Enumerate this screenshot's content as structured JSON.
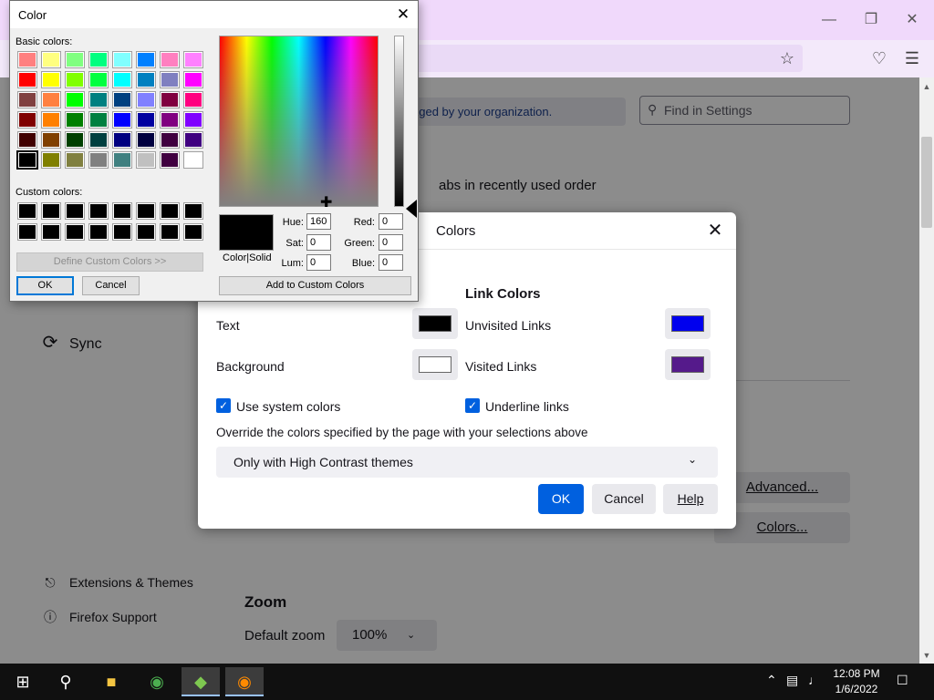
{
  "browser": {
    "window_controls": {
      "minimize_icon": "minimize-icon",
      "restore_icon": "restore-icon",
      "close_icon": "close-icon"
    },
    "toolbar": {
      "bookmark_icon": "star-icon",
      "pocket_icon": "pocket-icon",
      "menu_icon": "hamburger-menu-icon"
    },
    "settings": {
      "managed_notice": "aged by your organization.",
      "find_placeholder": "Find in Settings",
      "tabs_text": "abs in recently used order",
      "advanced_button": "Advanced...",
      "colors_button": "Colors...",
      "zoom_heading": "Zoom",
      "default_zoom_label": "Default zoom",
      "default_zoom_value": "100%",
      "sidebar": {
        "sync": "Sync",
        "extensions": "Extensions & Themes",
        "support": "Firefox Support"
      }
    }
  },
  "colors_dialog": {
    "title": "Colors",
    "link_colors_heading": "Link Colors",
    "text_label": "Text",
    "background_label": "Background",
    "unvisited_label": "Unvisited Links",
    "visited_label": "Visited Links",
    "use_system_colors": "Use system colors",
    "underline_links": "Underline links",
    "override_label": "Override the colors specified by the page with your selections above",
    "override_value": "Only with High Contrast themes",
    "ok": "OK",
    "cancel": "Cancel",
    "help": "Help",
    "colors": {
      "text": "#000000",
      "background": "#ffffff",
      "unvisited": "#0000ee",
      "visited": "#551a8b",
      "accent": "#0060df"
    }
  },
  "color_picker": {
    "title": "Color",
    "basic_colors_label": "Basic colors:",
    "custom_colors_label": "Custom colors:",
    "define_custom_button": "Define Custom Colors >>",
    "ok": "OK",
    "cancel": "Cancel",
    "add_custom_button": "Add to Custom Colors",
    "color_solid_label": "Color|Solid",
    "fields": {
      "hue_label": "Hue:",
      "hue": "160",
      "sat_label": "Sat:",
      "sat": "0",
      "lum_label": "Lum:",
      "lum": "0",
      "red_label": "Red:",
      "red": "0",
      "green_label": "Green:",
      "green": "0",
      "blue_label": "Blue:",
      "blue": "0"
    },
    "basic_colors": [
      [
        "#ff8080",
        "#ffff80",
        "#80ff80",
        "#00ff80",
        "#80ffff",
        "#0080ff",
        "#ff80c0",
        "#ff80ff"
      ],
      [
        "#ff0000",
        "#ffff00",
        "#80ff00",
        "#00ff40",
        "#00ffff",
        "#0080c0",
        "#8080c0",
        "#ff00ff"
      ],
      [
        "#804040",
        "#ff8040",
        "#00ff00",
        "#008080",
        "#004080",
        "#8080ff",
        "#800040",
        "#ff0080"
      ],
      [
        "#800000",
        "#ff8000",
        "#008000",
        "#008040",
        "#0000ff",
        "#0000a0",
        "#800080",
        "#8000ff"
      ],
      [
        "#400000",
        "#804000",
        "#004000",
        "#004040",
        "#000080",
        "#000040",
        "#400040",
        "#400080"
      ],
      [
        "#000000",
        "#808000",
        "#808040",
        "#808080",
        "#408080",
        "#c0c0c0",
        "#400040",
        "#ffffff"
      ]
    ],
    "selected_basic_color": "#000000",
    "custom_colors": [
      [
        "#000000",
        "#000000",
        "#000000",
        "#000000",
        "#000000",
        "#000000",
        "#000000",
        "#000000"
      ],
      [
        "#000000",
        "#000000",
        "#000000",
        "#000000",
        "#000000",
        "#000000",
        "#000000",
        "#000000"
      ]
    ]
  },
  "taskbar": {
    "time": "12:08 PM",
    "date": "1/6/2022",
    "apps": [
      "start-icon",
      "search-icon",
      "file-explorer-icon",
      "chrome-icon",
      "app-icon",
      "firefox-icon"
    ]
  }
}
